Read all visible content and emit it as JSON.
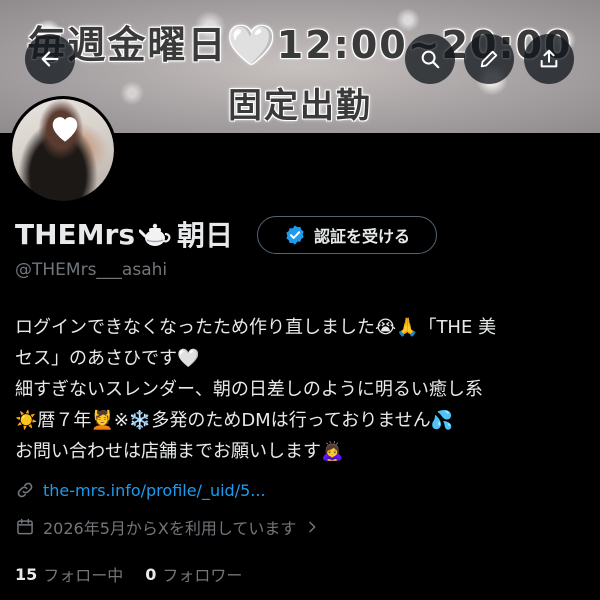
{
  "banner": {
    "line1": "毎週金曜日🤍12:00~20:00",
    "line2": "固定出勤"
  },
  "header_buttons": {
    "back": "arrow-left-icon",
    "search": "search-icon",
    "edit": "pencil-icon",
    "share": "share-icon"
  },
  "profile": {
    "display_name": "THEMrs",
    "display_name_suffix": "朝日",
    "verify_button_label": "認証を受ける",
    "handle": "@THEMrs___asahi",
    "bio_lines": [
      "ログインできなくなったため作り直しました😭🙏「THE 美",
      "セス」のあさひです🤍",
      "細すぎないスレンダー、朝の日差しのように明るい癒し系",
      "☀️暦７年💆※❄️多発のためDMは行っておりません💦",
      "お問い合わせは店舗までお願いします🙇‍♀️"
    ],
    "link": "the-mrs.info/profile/_uid/5...",
    "joined": "2026年5月からXを利用しています",
    "following_count": "15",
    "following_label": "フォロー中",
    "followers_count": "0",
    "followers_label": "フォロワー"
  },
  "colors": {
    "accent": "#1d9bf0",
    "muted": "#71767b",
    "text": "#e7e9ea",
    "background": "#000000"
  }
}
